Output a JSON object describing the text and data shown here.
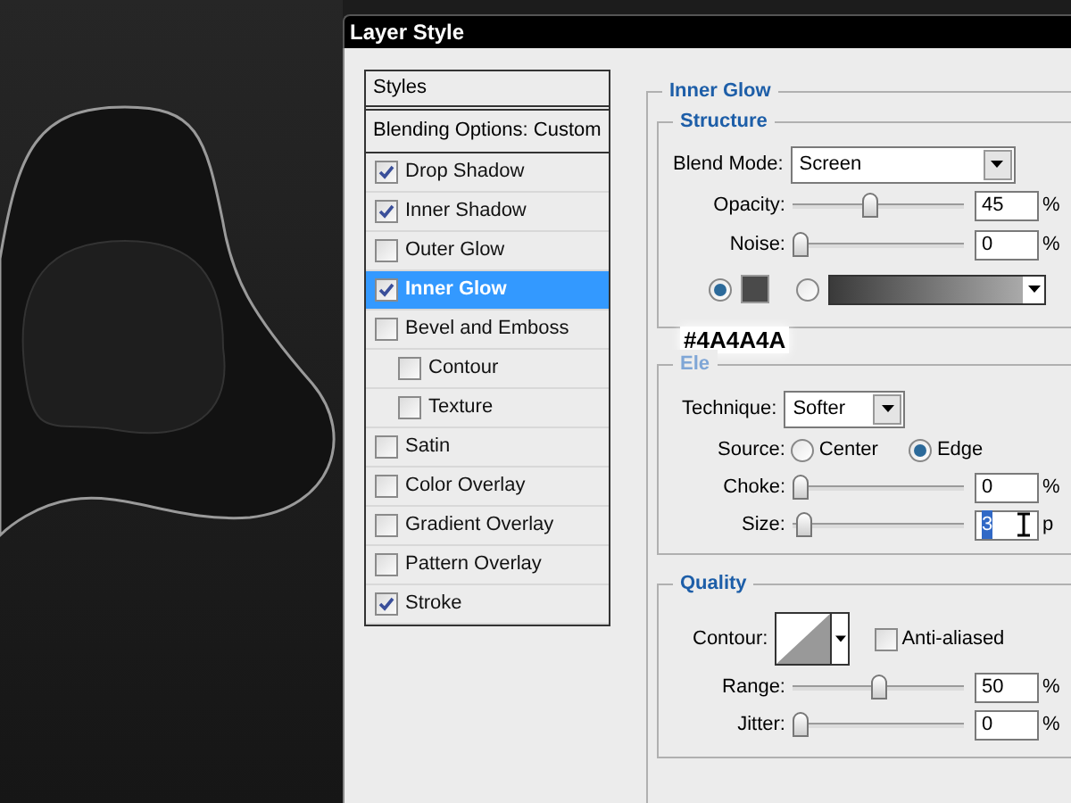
{
  "window": {
    "title": "Layer Style"
  },
  "styles_list": {
    "header": "Styles",
    "blending": "Blending Options: Custom",
    "items": [
      {
        "label": "Drop Shadow",
        "checked": true,
        "selected": false
      },
      {
        "label": "Inner Shadow",
        "checked": true,
        "selected": false
      },
      {
        "label": "Outer Glow",
        "checked": false,
        "selected": false
      },
      {
        "label": "Inner Glow",
        "checked": true,
        "selected": true
      },
      {
        "label": "Bevel and Emboss",
        "checked": false,
        "selected": false,
        "children": [
          {
            "label": "Contour",
            "checked": false,
            "selected": false
          },
          {
            "label": "Texture",
            "checked": false,
            "selected": false
          }
        ]
      },
      {
        "label": "Satin",
        "checked": false,
        "selected": false
      },
      {
        "label": "Color Overlay",
        "checked": false,
        "selected": false
      },
      {
        "label": "Gradient Overlay",
        "checked": false,
        "selected": false
      },
      {
        "label": "Pattern Overlay",
        "checked": false,
        "selected": false
      },
      {
        "label": "Stroke",
        "checked": true,
        "selected": false
      }
    ]
  },
  "inner_glow": {
    "title": "Inner Glow",
    "structure": {
      "title": "Structure",
      "blend_mode": {
        "label": "Blend Mode:",
        "value": "Screen"
      },
      "sliders": [
        {
          "label": "Opacity:",
          "level": 0.45,
          "value": "45",
          "unit": "%"
        },
        {
          "label": "Noise:",
          "level": 0,
          "value": "0",
          "unit": "%"
        }
      ],
      "fill_options": [
        {
          "kind": "color",
          "selected": true,
          "color": "#4a4a4a"
        },
        {
          "kind": "gradient",
          "selected": false
        }
      ],
      "tooltip": "#4A4A4A"
    },
    "elements": {
      "title": "Ele",
      "technique": {
        "label": "Technique:",
        "value": "Softer"
      },
      "source": {
        "label": "Source:",
        "options": [
          {
            "label": "Center",
            "selected": false
          },
          {
            "label": "Edge",
            "selected": true
          }
        ]
      },
      "sliders": [
        {
          "label": "Choke:",
          "level": 0,
          "value": "0",
          "unit": "%"
        },
        {
          "label": "Size:",
          "level": 0.02,
          "value": "3",
          "unit": "p",
          "text_selected": true
        }
      ]
    },
    "quality": {
      "title": "Quality",
      "contour_label": "Contour:",
      "anti_aliased": {
        "label": "Anti-aliased",
        "checked": false
      },
      "sliders": [
        {
          "label": "Range:",
          "level": 0.5,
          "value": "50",
          "unit": "%"
        },
        {
          "label": "Jitter:",
          "level": 0,
          "value": "0",
          "unit": "%"
        }
      ]
    }
  }
}
